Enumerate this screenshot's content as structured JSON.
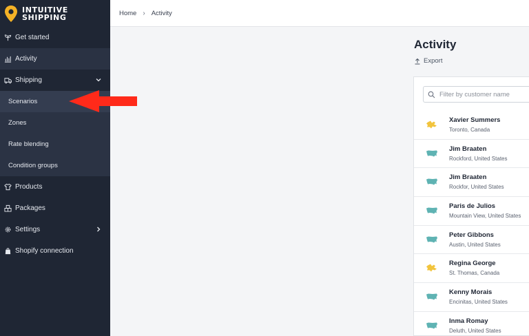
{
  "brand": {
    "line1": "INTUITIVE",
    "line2": "SHIPPING",
    "pin_color": "#f4b226"
  },
  "breadcrumb": {
    "home": "Home",
    "current": "Activity"
  },
  "sidebar": {
    "items": [
      {
        "label": "Get started",
        "icon": "seedling-icon"
      },
      {
        "label": "Activity",
        "icon": "bar-chart-icon",
        "active": true
      },
      {
        "label": "Shipping",
        "icon": "truck-icon",
        "expanded": true
      },
      {
        "label": "Products",
        "icon": "shirt-icon"
      },
      {
        "label": "Packages",
        "icon": "boxes-icon"
      },
      {
        "label": "Settings",
        "icon": "gear-icon"
      },
      {
        "label": "Shopify connection",
        "icon": "shopify-bag-icon"
      }
    ],
    "shipping_sub": [
      "Scenarios",
      "Zones",
      "Rate blending",
      "Condition groups"
    ]
  },
  "page": {
    "title": "Activity",
    "export_label": "Export"
  },
  "search": {
    "placeholder": "Filter by customer name"
  },
  "customers": [
    {
      "name": "Xavier Summers",
      "location": "Toronto, Canada",
      "country": "canada"
    },
    {
      "name": "Jim Braaten",
      "location": "Rockford, United States",
      "country": "usa"
    },
    {
      "name": "Jim Braaten",
      "location": "Rockfor, United States",
      "country": "usa"
    },
    {
      "name": "Paris de Julios",
      "location": "Mountain View, United States",
      "country": "usa"
    },
    {
      "name": "Peter Gibbons",
      "location": "Austin, United States",
      "country": "usa"
    },
    {
      "name": "Regina George",
      "location": "St. Thomas, Canada",
      "country": "canada"
    },
    {
      "name": "Kenny Morais",
      "location": "Encinitas, United States",
      "country": "usa"
    },
    {
      "name": "Inma Romay",
      "location": "Deluth, United States",
      "country": "usa"
    }
  ],
  "colors": {
    "sidebar_bg": "#1f2634",
    "usa_map": "#5fb3b3",
    "canada_map": "#f2c43d",
    "annotation_arrow": "#ff2a1a"
  }
}
